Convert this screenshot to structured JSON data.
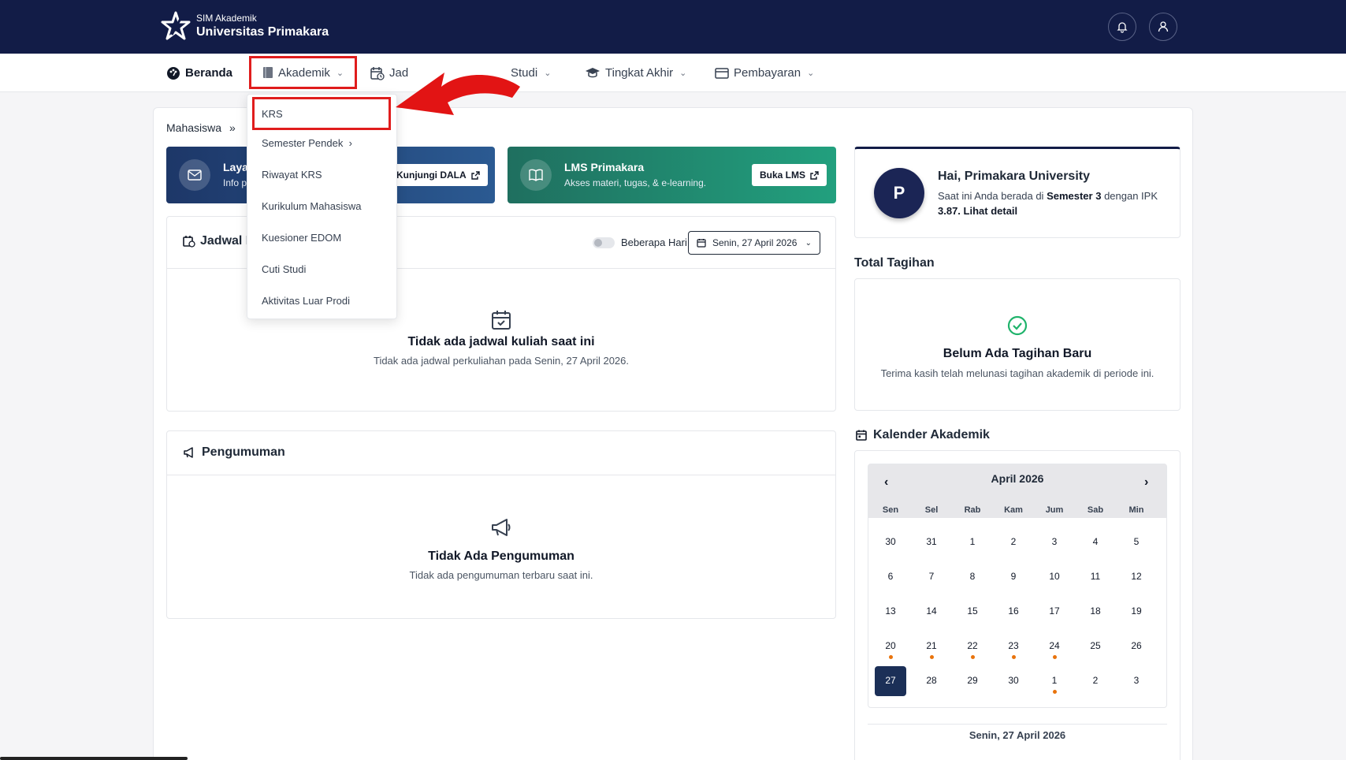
{
  "brand": {
    "sub": "SIM Akademik",
    "name": "Universitas Primakara"
  },
  "nav": {
    "beranda": "Beranda",
    "akademik": "Akademik",
    "jadwal": "Jad",
    "studi": "Studi",
    "tingkat": "Tingkat Akhir",
    "pembayaran": "Pembayaran"
  },
  "dropdown": {
    "items": [
      "KRS",
      "Semester Pendek",
      "Riwayat KRS",
      "Kurikulum Mahasiswa",
      "Kuesioner EDOM",
      "Cuti Studi",
      "Aktivitas Luar Prodi"
    ]
  },
  "breadcrumb": {
    "first": "Mahasiswa",
    "sep": "»"
  },
  "banners": {
    "layanan_title": "Laya",
    "layanan_sub": "Info p",
    "layanan_btn": "Kunjungi DALA",
    "lms_title": "LMS Primakara",
    "lms_sub": "Akses materi, tugas, & e-learning.",
    "lms_btn": "Buka LMS"
  },
  "jadwal": {
    "title": "Jadwal K",
    "toggle_label": "Beberapa Hari",
    "date": "Senin, 27 April 2026",
    "empty_title": "Tidak ada jadwal kuliah saat ini",
    "empty_sub": "Tidak ada jadwal perkuliahan pada Senin, 27 April 2026."
  },
  "pengumuman": {
    "title": "Pengumuman",
    "empty_title": "Tidak Ada Pengumuman",
    "empty_sub": "Tidak ada pengumuman terbaru saat ini."
  },
  "profile": {
    "initial": "P",
    "greeting": "Hai, Primakara University",
    "line_pre": "Saat ini Anda berada di ",
    "semester": "Semester 3",
    "line_mid": " dengan IPK",
    "ipk": "3.87.",
    "detail": " Lihat detail"
  },
  "tagihan": {
    "section_title": "Total Tagihan",
    "title": "Belum Ada Tagihan Baru",
    "sub": "Terima kasih telah melunasi tagihan akademik di periode ini."
  },
  "kalender": {
    "section_title": "Kalender Akademik",
    "month": "April 2026",
    "prev": "‹",
    "next": "›",
    "dow": [
      "Sen",
      "Sel",
      "Rab",
      "Kam",
      "Jum",
      "Sab",
      "Min"
    ],
    "weeks": [
      [
        "30",
        "31",
        "1",
        "2",
        "3",
        "4",
        "5"
      ],
      [
        "6",
        "7",
        "8",
        "9",
        "10",
        "11",
        "12"
      ],
      [
        "13",
        "14",
        "15",
        "16",
        "17",
        "18",
        "19"
      ],
      [
        "20",
        "21",
        "22",
        "23",
        "24",
        "25",
        "26"
      ],
      [
        "27",
        "28",
        "29",
        "30",
        "1",
        "2",
        "3"
      ]
    ],
    "selected_day": "27",
    "selected_date": "Senin, 27 April 2026",
    "accent": "#e8730c"
  },
  "colors": {
    "topbar": "#121c47",
    "highlight": "#e01d1d"
  }
}
